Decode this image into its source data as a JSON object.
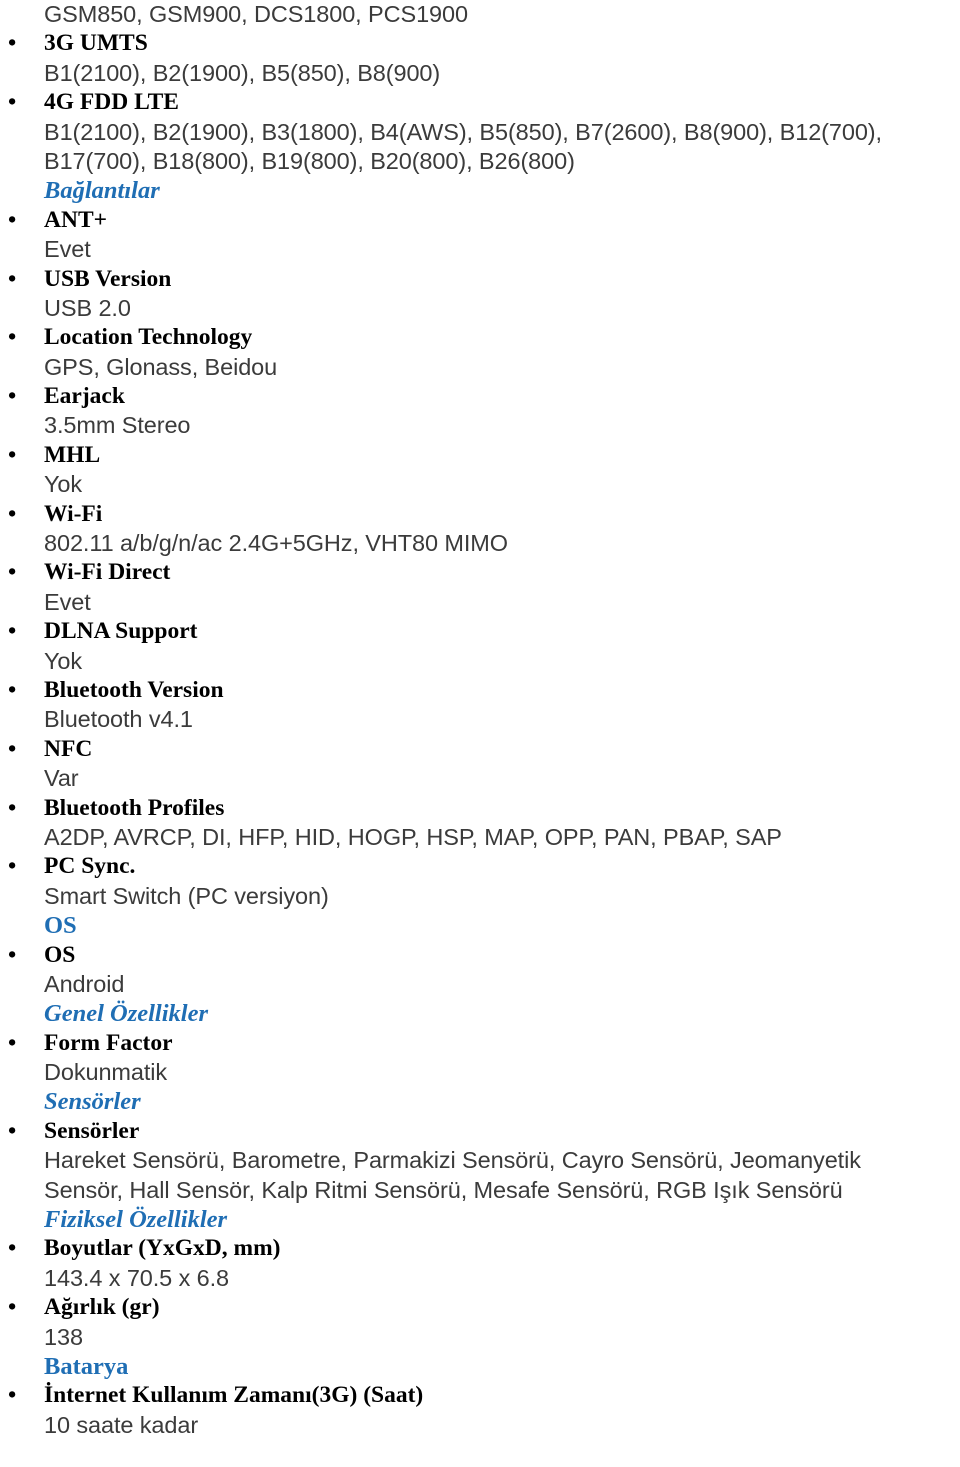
{
  "document": {
    "accent_color": "#1f6eb4",
    "body_color": "#3b3b3b",
    "label_color": "#000000",
    "bullet_glyph": "•",
    "lines": [
      {
        "kind": "value",
        "text": "GSM850, GSM900, DCS1800, PCS1900"
      },
      {
        "kind": "item",
        "text": "3G UMTS"
      },
      {
        "kind": "value",
        "text": "B1(2100), B2(1900), B5(850), B8(900)"
      },
      {
        "kind": "item",
        "text": "4G FDD LTE"
      },
      {
        "kind": "value",
        "text": "B1(2100), B2(1900), B3(1800), B4(AWS), B5(850), B7(2600), B8(900), B12(700),"
      },
      {
        "kind": "value",
        "text": "B17(700), B18(800), B19(800), B20(800), B26(800)"
      },
      {
        "kind": "heading",
        "style": "italic",
        "text": "Bağlantılar"
      },
      {
        "kind": "item",
        "text": "ANT+"
      },
      {
        "kind": "value",
        "text": "Evet"
      },
      {
        "kind": "item",
        "text": "USB Version"
      },
      {
        "kind": "value",
        "text": "USB 2.0"
      },
      {
        "kind": "item",
        "text": "Location Technology"
      },
      {
        "kind": "value",
        "text": "GPS, Glonass, Beidou"
      },
      {
        "kind": "item",
        "text": "Earjack"
      },
      {
        "kind": "value",
        "text": "3.5mm Stereo"
      },
      {
        "kind": "item",
        "text": "MHL"
      },
      {
        "kind": "value",
        "text": "Yok"
      },
      {
        "kind": "item",
        "text": "Wi-Fi"
      },
      {
        "kind": "value",
        "text": "802.11 a/b/g/n/ac 2.4G+5GHz, VHT80 MIMO"
      },
      {
        "kind": "item",
        "text": "Wi-Fi Direct"
      },
      {
        "kind": "value",
        "text": "Evet"
      },
      {
        "kind": "item",
        "text": "DLNA Support"
      },
      {
        "kind": "value",
        "text": "Yok"
      },
      {
        "kind": "item",
        "text": "Bluetooth Version"
      },
      {
        "kind": "value",
        "text": "Bluetooth v4.1"
      },
      {
        "kind": "item",
        "text": "NFC"
      },
      {
        "kind": "value",
        "text": "Var"
      },
      {
        "kind": "item",
        "text": "Bluetooth Profiles"
      },
      {
        "kind": "value",
        "text": "A2DP, AVRCP, DI, HFP, HID, HOGP, HSP, MAP, OPP, PAN, PBAP, SAP"
      },
      {
        "kind": "item",
        "text": "PC Sync."
      },
      {
        "kind": "value",
        "text": "Smart Switch (PC versiyon)"
      },
      {
        "kind": "heading",
        "style": "upright",
        "text": "OS"
      },
      {
        "kind": "item",
        "text": "OS"
      },
      {
        "kind": "value",
        "text": "Android"
      },
      {
        "kind": "heading",
        "style": "italic",
        "text": "Genel Özellikler"
      },
      {
        "kind": "item",
        "text": "Form Factor"
      },
      {
        "kind": "value",
        "text": "Dokunmatik"
      },
      {
        "kind": "heading",
        "style": "italic",
        "text": "Sensörler"
      },
      {
        "kind": "item",
        "text": "Sensörler"
      },
      {
        "kind": "value",
        "text": "Hareket Sensörü, Barometre, Parmakizi Sensörü, Cayro Sensörü, Jeomanyetik"
      },
      {
        "kind": "value",
        "text": "Sensör, Hall Sensör, Kalp Ritmi Sensörü, Mesafe Sensörü, RGB Işık Sensörü"
      },
      {
        "kind": "heading",
        "style": "italic",
        "text": "Fiziksel Özellikler"
      },
      {
        "kind": "item",
        "text": "Boyutlar (YxGxD, mm)"
      },
      {
        "kind": "value",
        "text": "143.4 x 70.5 x 6.8"
      },
      {
        "kind": "item",
        "text": "Ağırlık (gr)"
      },
      {
        "kind": "value",
        "text": "138"
      },
      {
        "kind": "heading",
        "style": "upright",
        "text": "Batarya"
      },
      {
        "kind": "item",
        "text": "İnternet Kullanım Zamanı(3G) (Saat)"
      },
      {
        "kind": "value",
        "text": "10 saate kadar"
      }
    ]
  }
}
